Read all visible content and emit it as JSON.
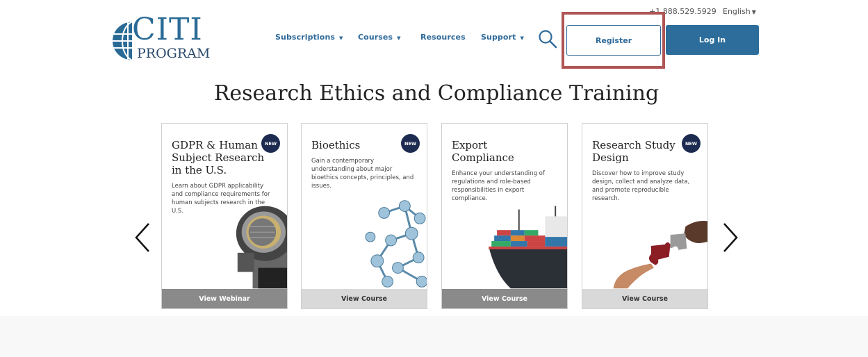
{
  "header": {
    "logo": {
      "top": "CITI",
      "bottom": "PROGRAM"
    },
    "phone": "+1.888.529.5929",
    "language": "English",
    "nav": [
      {
        "label": "Subscriptions",
        "has_dropdown": true
      },
      {
        "label": "Courses",
        "has_dropdown": true
      },
      {
        "label": "Resources",
        "has_dropdown": false
      },
      {
        "label": "Support",
        "has_dropdown": true
      }
    ],
    "register_label": "Register",
    "login_label": "Log In",
    "search_icon": "search-icon"
  },
  "main": {
    "title": "Research Ethics and Compliance Training",
    "cards": [
      {
        "title": "GDPR & Human Subject Research in the U.S.",
        "badge": "NEW",
        "description": "Learn about GDPR applicability and compliance requirements for human subjects research in the U.S.",
        "cta": "View Webinar"
      },
      {
        "title": "Bioethics",
        "badge": "NEW",
        "description": "Gain a contemporary understanding about major bioethics concepts, principles, and issues.",
        "cta": "View Course"
      },
      {
        "title": "Export Compliance",
        "badge": "",
        "description": "Enhance your understanding of regulations and role-based responsibilities in export compliance.",
        "cta": "View Course"
      },
      {
        "title": "Research Study Design",
        "badge": "NEW",
        "description": "Discover how to improve study design, collect and analyze data, and promote reproducible research.",
        "cta": "View Course"
      }
    ]
  },
  "colors": {
    "brand_blue": "#2c6d9b",
    "badge_navy": "#1c2b4f",
    "highlight_red": "#b05555"
  }
}
